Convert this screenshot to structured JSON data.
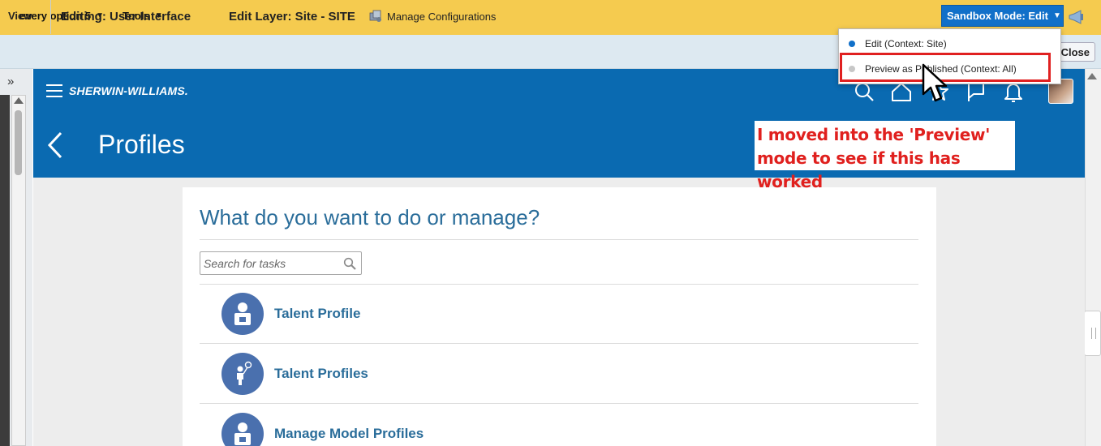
{
  "toolbar": {
    "menu1_label": "every option 5",
    "menu2_label": "Tools",
    "sandbox_label": "Sandbox Mode: Edit"
  },
  "edit_bar": {
    "view_label": "View",
    "editing_title": "Editing: User Interface",
    "edit_layer": "Edit Layer: Site - SITE",
    "manage_configurations": "Manage Configurations",
    "close_label": "Close"
  },
  "sandbox_menu": {
    "items": [
      {
        "label": "Edit (Context: Site)",
        "dot_color": "#1170c9"
      },
      {
        "label": "Preview as Published (Context: All)",
        "dot_color": "#c7c7c7"
      }
    ]
  },
  "app_header": {
    "brand": "SHERWIN-WILLIAMS.",
    "page_title": "Profiles",
    "icons": [
      "search-icon",
      "home-icon",
      "star-icon",
      "flag-icon",
      "bell-icon",
      "avatar"
    ]
  },
  "main": {
    "heading": "What do you want to do or manage?",
    "search_placeholder": "Search for tasks",
    "tasks": [
      {
        "label": "Talent Profile",
        "icon": "person-badge-icon"
      },
      {
        "label": "Talent Profiles",
        "icon": "person-balloon-icon"
      },
      {
        "label": "Manage Model Profiles",
        "icon": "person-badge-icon"
      }
    ]
  },
  "annotation": {
    "line1": "I moved into the 'Preview'",
    "line2": "mode to see if this has worked"
  },
  "colors": {
    "toolbar_bg": "#f5cb4f",
    "header_blue": "#0a6ab1",
    "accent_blue": "#1170c9",
    "link_blue": "#2a6d9a",
    "task_circle": "#4a70ae",
    "annotation_red": "#e0201e"
  }
}
